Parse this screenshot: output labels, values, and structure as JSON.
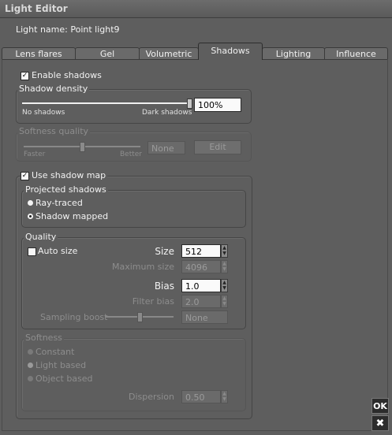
{
  "window": {
    "title": "Light Editor"
  },
  "light": {
    "name_label": "Light name: Point light9"
  },
  "tabs": [
    {
      "label": "Lens flares"
    },
    {
      "label": "Gel"
    },
    {
      "label": "Volumetric"
    },
    {
      "label": "Shadows",
      "active": true
    },
    {
      "label": "Lighting"
    },
    {
      "label": "Influence"
    }
  ],
  "shadows": {
    "enable_label": "Enable shadows",
    "enable_checked": true,
    "density": {
      "title": "Shadow density",
      "min_label": "No shadows",
      "max_label": "Dark shadows",
      "value": "100%",
      "level": 1.0
    },
    "softness_quality": {
      "title": "Softness quality",
      "min_label": "Faster",
      "max_label": "Better",
      "value": "None",
      "edit_label": "Edit",
      "level": 0.5
    },
    "use_map_label": "Use shadow map",
    "use_map_checked": true,
    "projected": {
      "title": "Projected shadows",
      "options": [
        "Ray-traced",
        "Shadow mapped"
      ],
      "selected": "Shadow mapped"
    },
    "quality": {
      "title": "Quality",
      "auto_size_label": "Auto size",
      "auto_size_checked": false,
      "size_label": "Size",
      "size_value": "512",
      "max_size_label": "Maximum size",
      "max_size_value": "4096",
      "bias_label": "Bias",
      "bias_value": "1.0",
      "filter_bias_label": "Filter bias",
      "filter_bias_value": "2.0",
      "sampling_boost_label": "Sampling boost",
      "sampling_boost_value": "None",
      "sampling_boost_level": 0.5
    },
    "softness": {
      "title": "Softness",
      "options": [
        "Constant",
        "Light based",
        "Object based"
      ],
      "selected": "Light based",
      "dispersion_label": "Dispersion",
      "dispersion_value": "0.50"
    }
  },
  "buttons": {
    "ok_label": "OK",
    "close_symbol": "✖"
  }
}
